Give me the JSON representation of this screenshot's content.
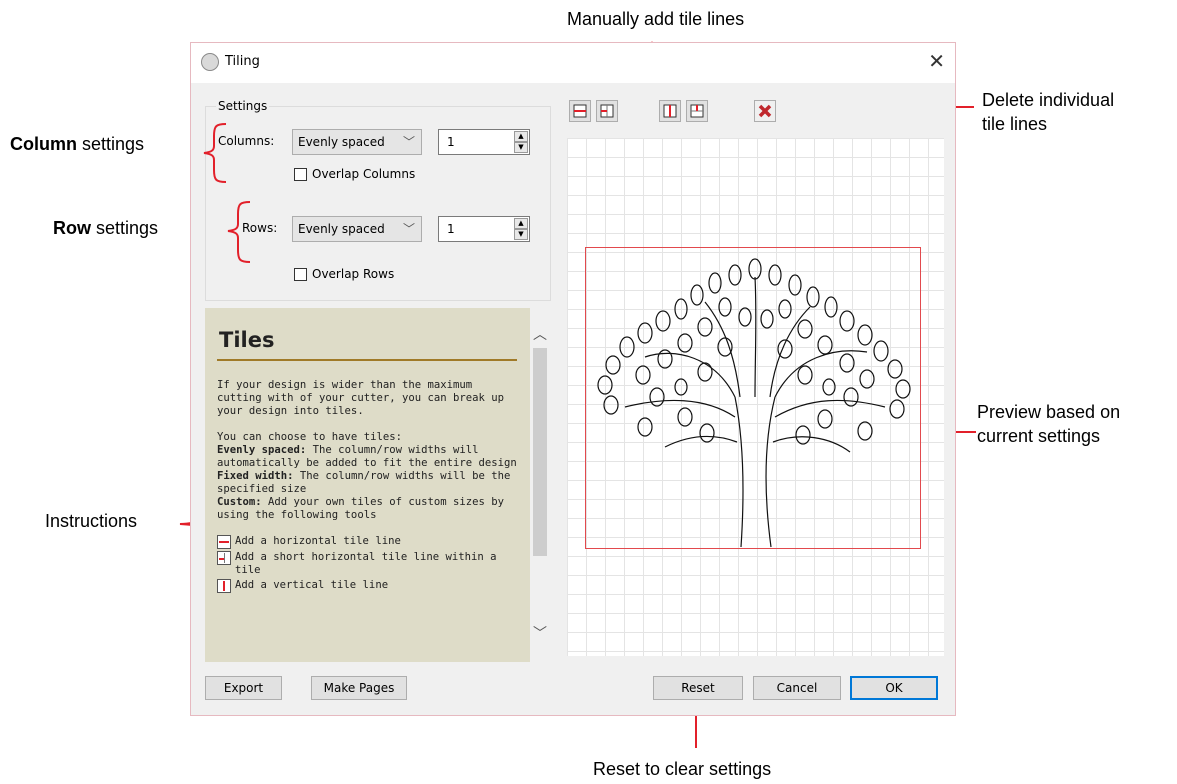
{
  "annotations": {
    "manual": "Manually add tile lines",
    "delete_line1": "Delete individual",
    "delete_line2": "tile lines",
    "column_bold": "Column",
    "column_rest": " settings",
    "row_bold": "Row",
    "row_rest": " settings",
    "preview_line1": "Preview based on",
    "preview_line2": "current settings",
    "instructions": "Instructions",
    "reset": "Reset to clear settings"
  },
  "dialog": {
    "title": "Tiling",
    "settings_label": "Settings",
    "columns_label": "Columns:",
    "columns_mode": "Evenly spaced",
    "columns_value": "1",
    "overlap_columns": "Overlap Columns",
    "rows_label": "Rows:",
    "rows_mode": "Evenly spaced",
    "rows_value": "1",
    "overlap_rows": "Overlap Rows"
  },
  "help": {
    "title": "Tiles",
    "intro": "If your design is wider than the maximum cutting with of your cutter, you can break up your design into tiles.",
    "choose": "You can choose to have tiles:",
    "even_bold": "Evenly spaced:",
    "even_text": " The column/row widths will automatically be added to fit the entire design",
    "fixed_bold": "Fixed width:",
    "fixed_text": " The column/row widths will be the specified size",
    "custom_bold": "Custom:",
    "custom_text": " Add your own tiles of custom sizes by using the following tools",
    "tool1": "Add a horizontal tile line",
    "tool2": "Add a short horizontal tile line within a tile",
    "tool3": "Add a vertical tile line"
  },
  "buttons": {
    "export": "Export",
    "make_pages": "Make Pages",
    "reset": "Reset",
    "cancel": "Cancel",
    "ok": "OK"
  },
  "colors": {
    "annotation_red": "#e2202a",
    "tile_frame": "#e2494d",
    "help_bg": "#dedcc8",
    "help_rule": "#a07a28",
    "ok_border": "#0078d7"
  }
}
